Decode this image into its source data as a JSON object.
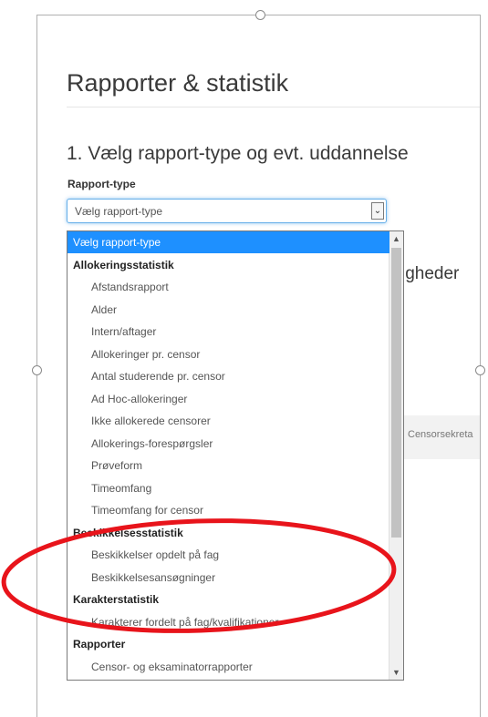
{
  "page": {
    "title": "Rapporter & statistik",
    "section_title": "1. Vælg rapport-type og evt. uddannelse"
  },
  "report_type": {
    "label": "Rapport-type",
    "selected_value": "Vælg rapport-type",
    "options": [
      {
        "label": "Vælg rapport-type",
        "kind": "selected"
      },
      {
        "label": "Allokeringsstatistik",
        "kind": "group"
      },
      {
        "label": "Afstandsrapport",
        "kind": "item"
      },
      {
        "label": "Alder",
        "kind": "item"
      },
      {
        "label": "Intern/aftager",
        "kind": "item"
      },
      {
        "label": "Allokeringer pr. censor",
        "kind": "item"
      },
      {
        "label": "Antal studerende pr. censor",
        "kind": "item"
      },
      {
        "label": "Ad Hoc-allokeringer",
        "kind": "item"
      },
      {
        "label": "Ikke allokerede censorer",
        "kind": "item"
      },
      {
        "label": "Allokerings-forespørgsler",
        "kind": "item"
      },
      {
        "label": "Prøveform",
        "kind": "item"
      },
      {
        "label": "Timeomfang",
        "kind": "item"
      },
      {
        "label": "Timeomfang for censor",
        "kind": "item"
      },
      {
        "label": "Beskikkelsesstatistik",
        "kind": "group"
      },
      {
        "label": "Beskikkelser opdelt på fag",
        "kind": "item"
      },
      {
        "label": "Beskikkelsesansøgninger",
        "kind": "item"
      },
      {
        "label": "Karakterstatistik",
        "kind": "group"
      },
      {
        "label": "Karakterer fordelt på fag/kvalifikationer",
        "kind": "item"
      },
      {
        "label": "Rapporter",
        "kind": "group"
      },
      {
        "label": "Censor- og eksaminatorrapporter",
        "kind": "item"
      }
    ]
  },
  "background": {
    "partial_heading": "igheder",
    "partial_tab": "Censorsekreta"
  },
  "colors": {
    "selected_option": "#1e90ff",
    "annotation": "#e8141b",
    "focus_border": "#66afe9"
  },
  "icons": {
    "select_arrow": "chevron-down-icon",
    "scroll_up": "scroll-up-icon",
    "scroll_down": "scroll-down-icon"
  }
}
